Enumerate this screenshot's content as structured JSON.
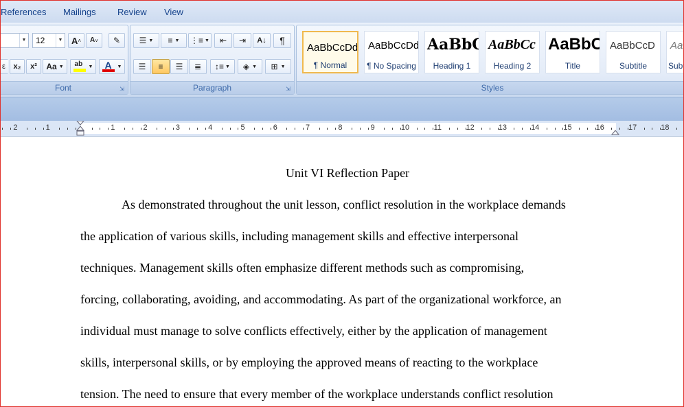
{
  "tabs": [
    "References",
    "Mailings",
    "Review",
    "View"
  ],
  "font_group": {
    "label": "Font",
    "size_value": "12",
    "grow_glyph": "A",
    "shrink_glyph": "A",
    "change_case": "Aa",
    "highlight_glyph": "ab",
    "font_color_glyph": "A"
  },
  "paragraph_group": {
    "label": "Paragraph"
  },
  "styles_group": {
    "label": "Styles",
    "items": [
      {
        "preview": "AaBbCcDd",
        "name": "¶ Normal"
      },
      {
        "preview": "AaBbCcDd",
        "name": "¶ No Spacing"
      },
      {
        "preview": "AaBbC",
        "name": "Heading 1"
      },
      {
        "preview": "AaBbCc",
        "name": "Heading 2"
      },
      {
        "preview": "AaBbC",
        "name": "Title"
      },
      {
        "preview": "AaBbCcD",
        "name": "Subtitle"
      },
      {
        "preview": "AaBbCcD",
        "name": "Subt"
      }
    ]
  },
  "ruler": {
    "left": [
      "2",
      "1"
    ],
    "right": [
      "1",
      "2",
      "3",
      "4",
      "5",
      "6",
      "7",
      "8",
      "9",
      "10",
      "11",
      "12",
      "13",
      "14",
      "15",
      "16",
      "17",
      "18"
    ]
  },
  "document": {
    "title": "Unit VI Reflection Paper",
    "lines": [
      "As demonstrated throughout the unit lesson, conflict resolution in the workplace demands",
      "the application of various skills, including management  skills and effective interpersonal",
      "techniques. Management skills often emphasize different methods such as compromising,",
      "forcing, collaborating, avoiding, and accommodating. As part of the organizational workforce, an",
      "individual must manage to solve conflicts effectively, either by the application of management",
      "skills, interpersonal skills, or by employing the approved means of reacting to the workplace",
      "tension. The need to ensure that every member of the workplace understands conflict resolution"
    ]
  },
  "colors": {
    "accent": "#15428b",
    "highlight": "#ffff00",
    "font_color": "#e00000",
    "frame": "#e0302a"
  }
}
